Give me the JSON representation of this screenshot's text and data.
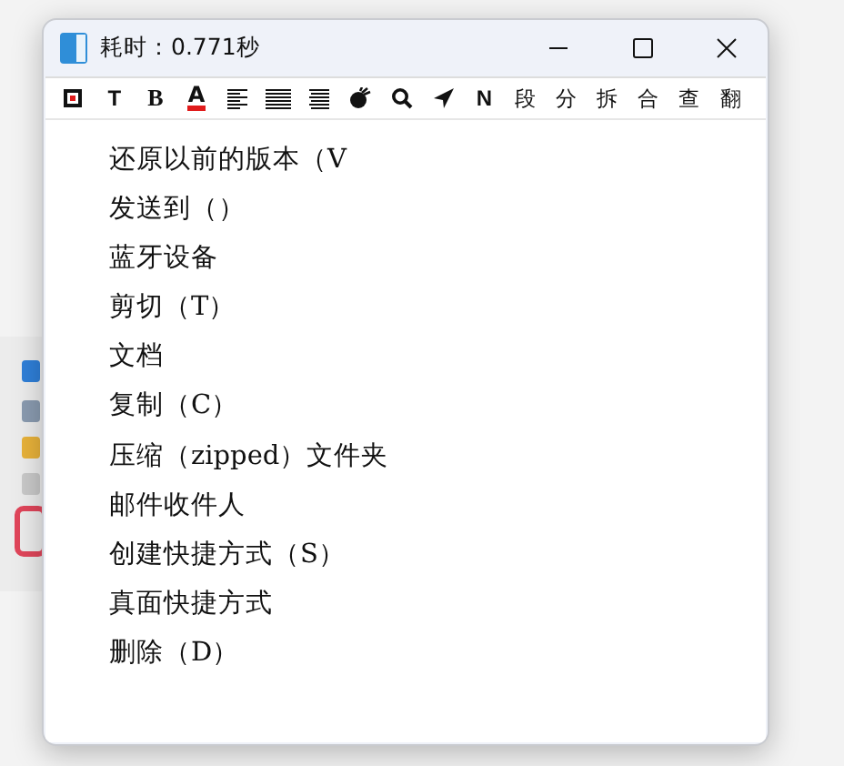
{
  "window": {
    "title": "耗时：0.771秒"
  },
  "toolbar": [
    {
      "kind": "stop"
    },
    {
      "kind": "text",
      "label": "T"
    },
    {
      "kind": "serif",
      "label": "B"
    },
    {
      "kind": "color-text",
      "label": "A"
    },
    {
      "kind": "align-left"
    },
    {
      "kind": "justify"
    },
    {
      "kind": "align-right"
    },
    {
      "kind": "brush"
    },
    {
      "kind": "search"
    },
    {
      "kind": "send"
    },
    {
      "kind": "text",
      "label": "N"
    },
    {
      "kind": "text",
      "label": "段"
    },
    {
      "kind": "text",
      "label": "分"
    },
    {
      "kind": "text",
      "label": "拆"
    },
    {
      "kind": "text",
      "label": "合"
    },
    {
      "kind": "text",
      "label": "查"
    },
    {
      "kind": "text",
      "label": "翻"
    }
  ],
  "lines": [
    "还原以前的版本（V",
    "发送到（）",
    "蓝牙设备",
    "剪切（T）",
    "文档",
    "复制（C）",
    "压缩（zipped）文件夹",
    "邮件收件人",
    "创建快捷方式（S）",
    "真面快捷方式",
    "删除（D）"
  ]
}
